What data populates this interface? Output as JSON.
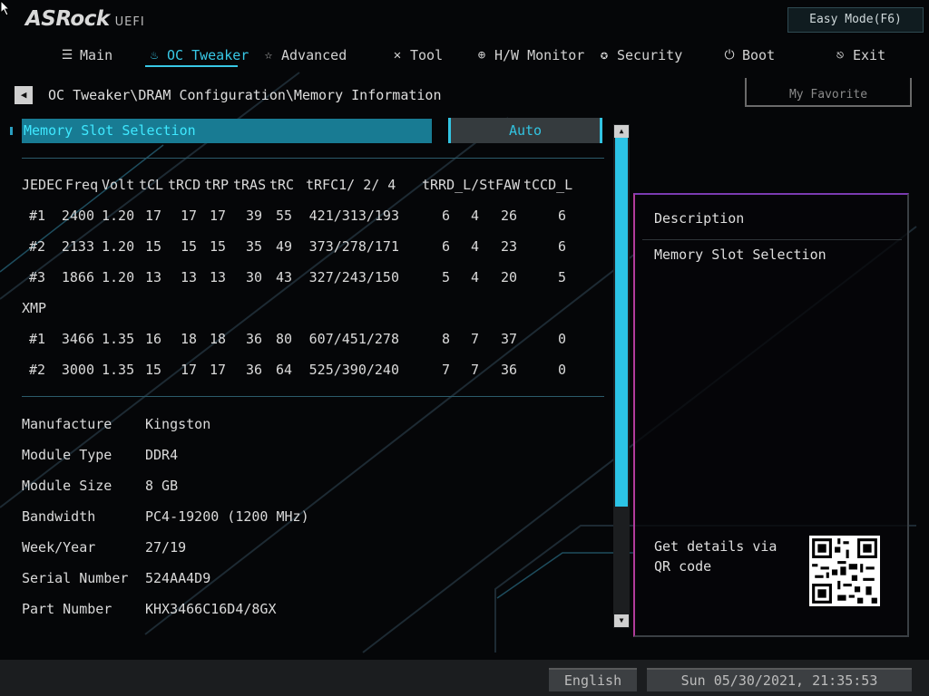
{
  "brand": {
    "logo": "ASRock",
    "suffix": "UEFI"
  },
  "easy_mode": "Easy Mode(F6)",
  "tabs": [
    {
      "label": "Main",
      "icon": "list-icon"
    },
    {
      "label": "OC Tweaker",
      "icon": "flame-icon"
    },
    {
      "label": "Advanced",
      "icon": "star-icon"
    },
    {
      "label": "Tool",
      "icon": "tools-icon"
    },
    {
      "label": "H/W Monitor",
      "icon": "monitor-icon"
    },
    {
      "label": "Security",
      "icon": "shield-icon"
    },
    {
      "label": "Boot",
      "icon": "power-icon"
    },
    {
      "label": "Exit",
      "icon": "exit-icon"
    }
  ],
  "active_tab": "OC Tweaker",
  "breadcrumb": "OC Tweaker\\DRAM Configuration\\Memory Information",
  "my_favorite": "My Favorite",
  "memory_slot": {
    "label": "Memory Slot Selection",
    "value": "Auto"
  },
  "timing_headers": [
    "JEDEC",
    "Freq",
    "Volt",
    "tCL",
    "tRCD",
    "tRP",
    "tRAS",
    "tRC",
    "tRFC1/  2/  4",
    "tRRD_L/S",
    "tFAW",
    "tCCD_L"
  ],
  "jedec_rows": [
    [
      "#1",
      "2400",
      "1.20",
      "17",
      "17",
      "17",
      "39",
      "55",
      "421/313/193",
      "6",
      "4",
      "26",
      "6"
    ],
    [
      "#2",
      "2133",
      "1.20",
      "15",
      "15",
      "15",
      "35",
      "49",
      "373/278/171",
      "6",
      "4",
      "23",
      "6"
    ],
    [
      "#3",
      "1866",
      "1.20",
      "13",
      "13",
      "13",
      "30",
      "43",
      "327/243/150",
      "5",
      "4",
      "20",
      "5"
    ]
  ],
  "xmp_label": "XMP",
  "xmp_rows": [
    [
      "#1",
      "3466",
      "1.35",
      "16",
      "18",
      "18",
      "36",
      "80",
      "607/451/278",
      "8",
      "7",
      "37",
      "0"
    ],
    [
      "#2",
      "3000",
      "1.35",
      "15",
      "17",
      "17",
      "36",
      "64",
      "525/390/240",
      "7",
      "7",
      "36",
      "0"
    ]
  ],
  "module_info": [
    {
      "label": "Manufacture",
      "value": "Kingston"
    },
    {
      "label": "Module Type",
      "value": "DDR4"
    },
    {
      "label": "Module Size",
      "value": "8 GB"
    },
    {
      "label": "Bandwidth",
      "value": "PC4-19200 (1200 MHz)"
    },
    {
      "label": "Week/Year",
      "value": "27/19"
    },
    {
      "label": "Serial Number",
      "value": "524AA4D9"
    },
    {
      "label": "Part   Number",
      "value": "KHX3466C16D4/8GX"
    }
  ],
  "description": {
    "title": "Description",
    "text": "Memory Slot Selection",
    "qr_text": "Get details via QR code"
  },
  "footer": {
    "language": "English",
    "datetime": "Sun 05/30/2021, 21:35:53"
  },
  "colors": {
    "accent": "#38c8e6",
    "highlight": "#187b93",
    "panel_border": "#b03b9a"
  }
}
